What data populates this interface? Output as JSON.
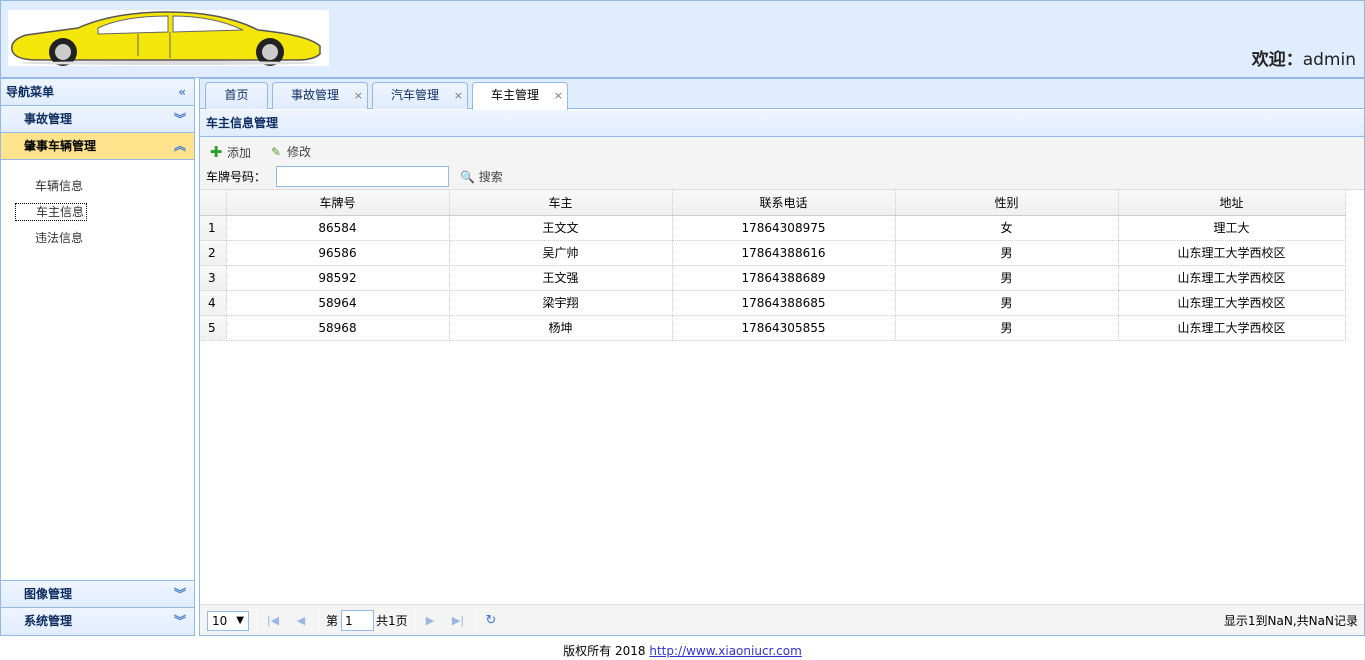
{
  "header": {
    "welcome_label": "欢迎：",
    "username": "admin"
  },
  "sidebar": {
    "title": "导航菜单",
    "sections": [
      {
        "label": "事故管理",
        "expanded": false
      },
      {
        "label": "肇事车辆管理",
        "expanded": true
      }
    ],
    "links": [
      {
        "label": "车辆信息",
        "active": false
      },
      {
        "label": "车主信息",
        "active": true
      },
      {
        "label": "违法信息",
        "active": false
      }
    ],
    "bottom_sections": [
      {
        "label": "图像管理"
      },
      {
        "label": "系统管理"
      }
    ]
  },
  "tabs": [
    {
      "label": "首页",
      "closable": false
    },
    {
      "label": "事故管理",
      "closable": true
    },
    {
      "label": "汽车管理",
      "closable": true
    },
    {
      "label": "车主管理",
      "closable": true,
      "active": true
    }
  ],
  "grid": {
    "title": "车主信息管理",
    "toolbar": {
      "add_label": "添加",
      "edit_label": "修改"
    },
    "search": {
      "label": "车牌号码：",
      "value": "",
      "button_label": "搜索"
    },
    "columns": [
      "车牌号",
      "车主",
      "联系电话",
      "性别",
      "地址"
    ],
    "rows": [
      [
        "1",
        "86584",
        "王文文",
        "17864308975",
        "女",
        "理工大"
      ],
      [
        "2",
        "96586",
        "吴广帅",
        "17864388616",
        "男",
        "山东理工大学西校区"
      ],
      [
        "3",
        "98592",
        "王文强",
        "17864388689",
        "男",
        "山东理工大学西校区"
      ],
      [
        "4",
        "58964",
        "梁宇翔",
        "17864388685",
        "男",
        "山东理工大学西校区"
      ],
      [
        "5",
        "58968",
        "杨坤",
        "17864305855",
        "男",
        "山东理工大学西校区"
      ]
    ]
  },
  "pager": {
    "page_size": "10",
    "page_prefix": "第",
    "page_number": "1",
    "page_suffix": "共1页",
    "display_info": "显示1到NaN,共NaN记录"
  },
  "footer": {
    "text": "版权所有 2018 ",
    "link": "http://www.xiaoniucr.com"
  },
  "colors": {
    "accent": "#95b8e7",
    "header_bg": "#e0ecff",
    "selected": "#ffe48d",
    "car_yellow": "#f5e60a"
  }
}
